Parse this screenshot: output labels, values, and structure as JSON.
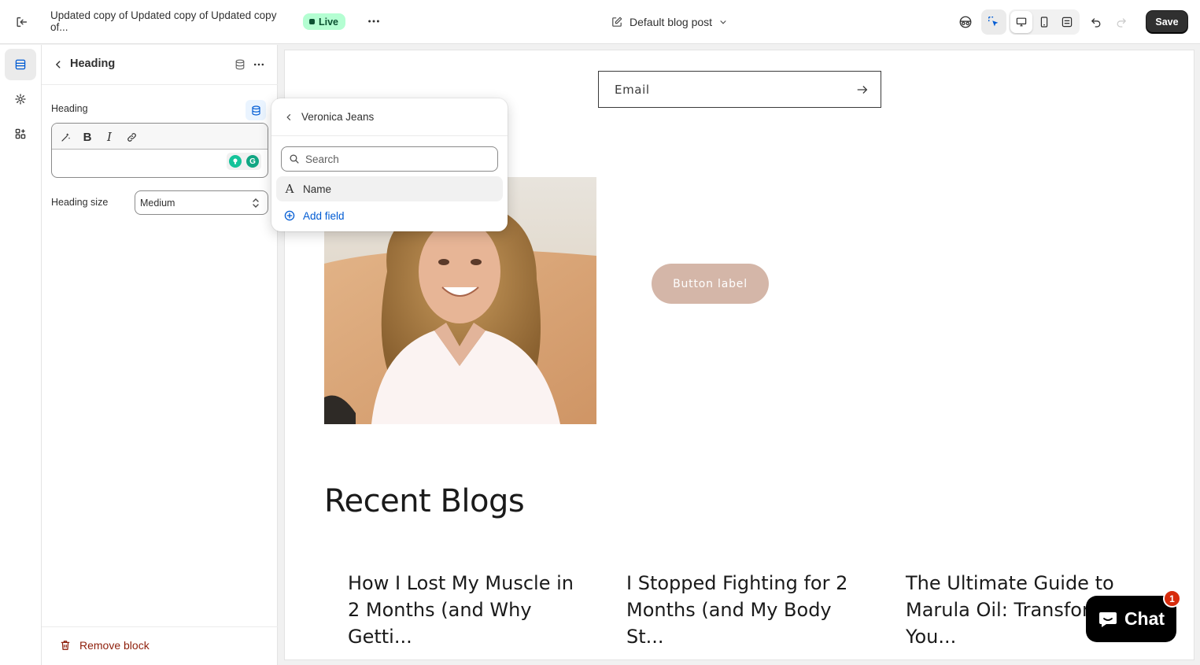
{
  "topbar": {
    "title": "Updated copy of Updated copy of Updated copy of...",
    "status": "Live",
    "template": "Default blog post",
    "save_label": "Save"
  },
  "panel": {
    "title": "Heading",
    "heading_label": "Heading",
    "heading_size_label": "Heading size",
    "heading_size_value": "Medium",
    "remove_label": "Remove block"
  },
  "popover": {
    "title": "Veronica Jeans",
    "search_placeholder": "Search",
    "item_label": "Name",
    "add_label": "Add field"
  },
  "preview": {
    "email_placeholder": "Email",
    "button_label": "Button label",
    "recent_title": "Recent Blogs",
    "blogs": [
      "How I Lost My Muscle in 2 Months (and Why Getti...",
      "I Stopped Fighting for 2 Months (and My Body St...",
      "The Ultimate Guide to Marula Oil: Transform You..."
    ]
  },
  "chat": {
    "label": "Chat",
    "badge": "1"
  },
  "colors": {
    "live_bg": "#b4fed2",
    "accent_blue": "#005bd3",
    "danger": "#8e1f0b",
    "hero_button": "#d4b6a8"
  }
}
